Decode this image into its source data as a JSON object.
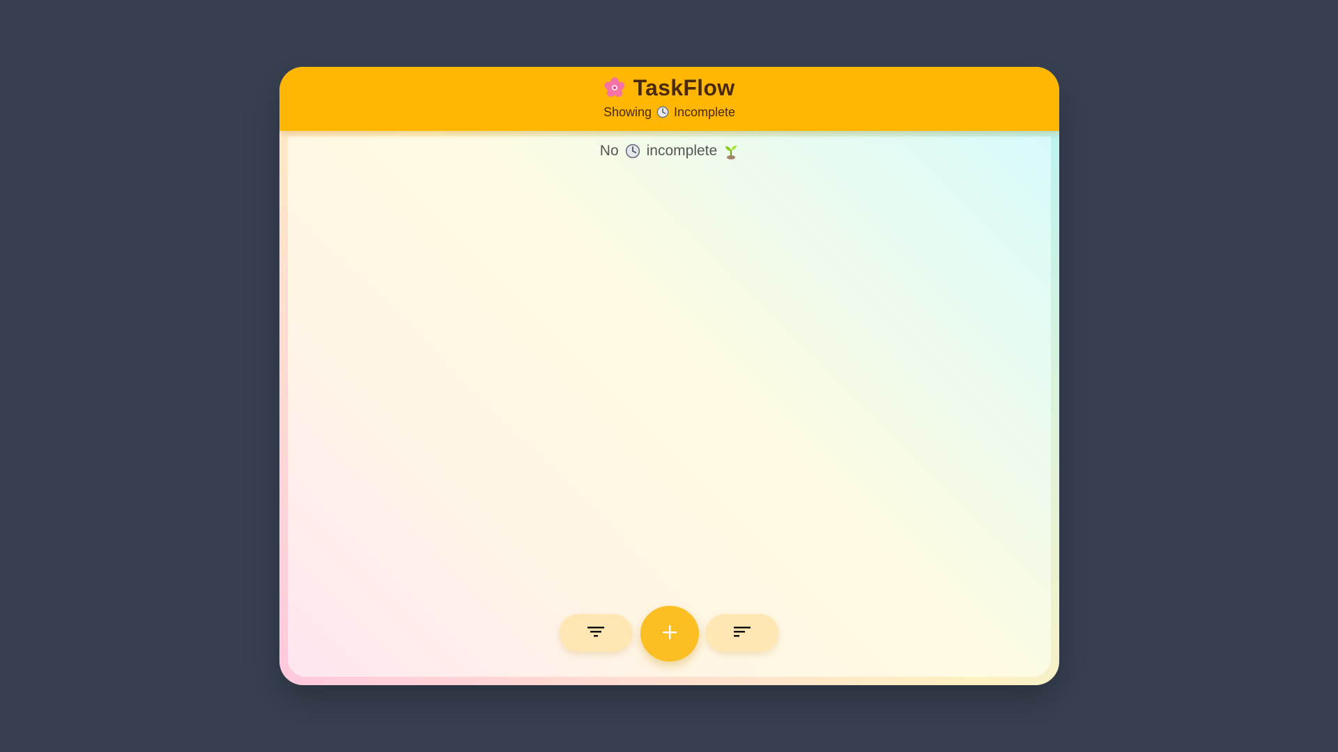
{
  "app": {
    "title": "TaskFlow",
    "logo_icon": "cherry-blossom-icon",
    "accent_color": "#ffb703"
  },
  "header": {
    "subtitle_prefix": "Showing",
    "subtitle_icon": "clock-icon",
    "subtitle_filter": "Incomplete"
  },
  "empty_state": {
    "prefix": "No",
    "icon": "clock-icon",
    "text": "incomplete",
    "trailing_icon": "sprout-icon"
  },
  "toolbar": {
    "filter_icon": "filter-icon",
    "add_icon": "plus-icon",
    "sort_icon": "sort-icon",
    "fab_color": "#fbbf24",
    "pill_color": "#ffe6b3"
  }
}
